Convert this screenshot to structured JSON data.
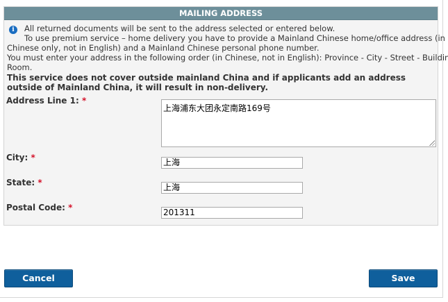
{
  "section": {
    "title": "MAILING ADDRESS"
  },
  "info": {
    "icon": "info-icon",
    "line1": "All returned documents will be sent to the address selected or entered below.",
    "line2": "To use premium service – home delivery you have to provide a Mainland Chinese home/office address (in",
    "line3": "Chinese only, not in English) and a Mainland Chinese personal phone number.",
    "line4": "You must enter your address in the following order (in Chinese, not in English): Province - City - Street - Building -",
    "line5": "Room.",
    "bold_note": "This service does not cover outside mainland China and if applicants add an address outside of Mainland China, it will result in non-delivery."
  },
  "form": {
    "required_marker": "*",
    "address_line1": {
      "label": "Address Line 1:",
      "value": "上海浦东大团永定南路169号"
    },
    "city": {
      "label": "City:",
      "value": "上海"
    },
    "state": {
      "label": "State:",
      "value": "上海"
    },
    "postal_code": {
      "label": "Postal Code:",
      "value": "201311"
    }
  },
  "actions": {
    "cancel": "Cancel",
    "save": "Save"
  },
  "colors": {
    "header_bg": "#6d8f9a",
    "button_bg": "#0f5f9c",
    "required": "#d4122a"
  }
}
